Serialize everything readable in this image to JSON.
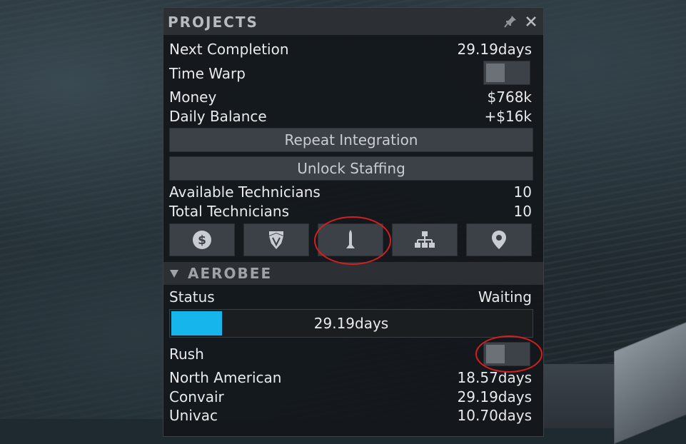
{
  "window": {
    "title": "PROJECTS"
  },
  "summary": {
    "next_completion_label": "Next Completion",
    "next_completion_value": "29.19days",
    "time_warp_label": "Time Warp",
    "time_warp_on": false,
    "money_label": "Money",
    "money_value": "$768k",
    "daily_balance_label": "Daily Balance",
    "daily_balance_value": "+$16k"
  },
  "buttons": {
    "repeat_integration": "Repeat Integration",
    "unlock_staffing": "Unlock Staffing"
  },
  "staff": {
    "available_label": "Available Technicians",
    "available_value": "10",
    "total_label": "Total Technicians",
    "total_value": "10"
  },
  "toolbar": {
    "icons": [
      "money-icon",
      "rank-badge-icon",
      "rocket-icon",
      "org-chart-icon",
      "location-pin-icon"
    ]
  },
  "project": {
    "name": "AEROBEE",
    "status_label": "Status",
    "status_value": "Waiting",
    "progress_text": "29.19days",
    "progress_fraction": 0.14,
    "rush_label": "Rush",
    "rush_on": false,
    "contractors": [
      {
        "name": "North American",
        "value": "18.57days"
      },
      {
        "name": "Convair",
        "value": "29.19days"
      },
      {
        "name": "Univac",
        "value": "10.70days"
      }
    ]
  },
  "colors": {
    "progress_fill": "#16b6ec",
    "annotation": "#d51e1e"
  }
}
